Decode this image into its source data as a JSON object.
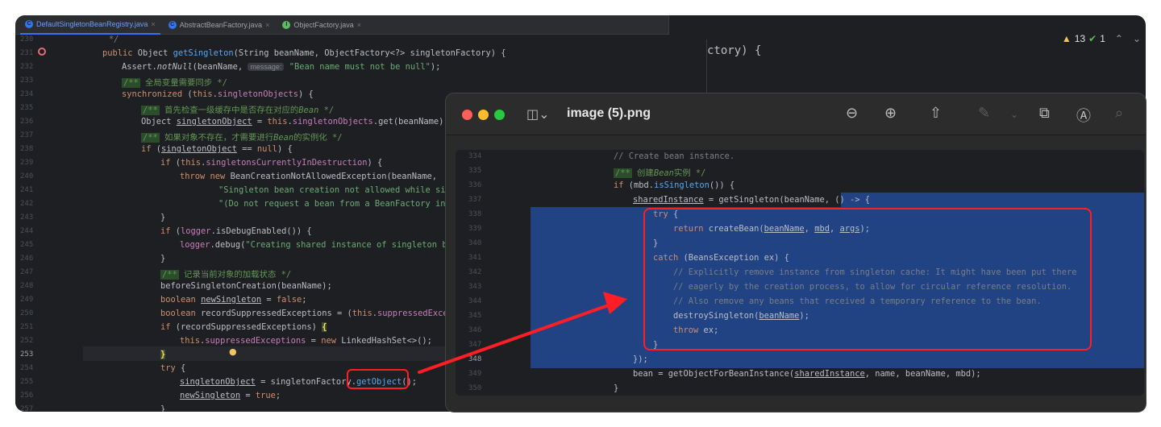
{
  "ide": {
    "tabs": [
      {
        "label": "DefaultSingletonBeanRegistry.java",
        "icon": "C",
        "color": "#3574f0",
        "active": true
      },
      {
        "label": "AbstractBeanFactory.java",
        "icon": "C",
        "color": "#3574f0",
        "active": false
      },
      {
        "label": "ObjectFactory.java",
        "icon": "I",
        "color": "#5fb865",
        "active": false
      }
    ],
    "close_glyph": "×",
    "line_numbers": [
      "230",
      "231",
      "232",
      "233",
      "234",
      "235",
      "236",
      "237",
      "238",
      "239",
      "240",
      "241",
      "242",
      "243",
      "244",
      "245",
      "246",
      "247",
      "248",
      "249",
      "250",
      "251",
      "252",
      "253",
      "254",
      "255",
      "256",
      "257"
    ],
    "code": {
      "l230": "*/",
      "l231_kw": "public",
      "l231_a": " Object ",
      "l231_fn": "getSingleton",
      "l231_b": "(String beanName, ObjectFactory<?> singletonFactory) {",
      "l232_a": "Assert.",
      "l232_fn": "notNull",
      "l232_b": "(beanName, ",
      "l232_hint": "message:",
      "l232_str": " \"Bean name must not be null\"",
      "l232_c": ");",
      "l233_doc": "/**",
      "l233_cmt": " 全局变量需要同步 */",
      "l234_kw": "synchronized",
      "l234_a": " (",
      "l234_kw2": "this",
      "l234_b": ".",
      "l234_field": "singletonObjects",
      "l234_c": ") {",
      "l235_doc": "/**",
      "l235_cmt": " 首先检查一级缓存中是否存在对应的",
      "l235_it": "Bean",
      "l235_end": " */",
      "l236_a": "Object ",
      "l236_ul": "singletonObject",
      "l236_b": " = ",
      "l236_kw": "this",
      "l236_c": ".",
      "l236_field": "singletonObjects",
      "l236_d": ".get(beanName);",
      "l237_doc": "/**",
      "l237_cmt": " 如果对象不存在，才需要进行",
      "l237_it": "Bean",
      "l237_end": "的实例化 */",
      "l238_kw": "if",
      "l238_a": " (",
      "l238_ul": "singletonObject",
      "l238_b": " == ",
      "l238_kw2": "null",
      "l238_c": ") {",
      "l239_kw": "if",
      "l239_a": " (",
      "l239_kw2": "this",
      "l239_b": ".",
      "l239_field": "singletonsCurrentlyInDestruction",
      "l239_c": ") {",
      "l240_kw": "throw new",
      "l240_a": " BeanCreationNotAllowedException(beanName,",
      "l241_str": "\"Singleton bean creation not allowed while sing",
      "l242_str": "\"(Do not request a bean from a BeanFactory in a",
      "l243": "}",
      "l244_kw": "if",
      "l244_a": " (",
      "l244_field": "logger",
      "l244_b": ".isDebugEnabled()) {",
      "l245_field": "logger",
      "l245_a": ".debug(",
      "l245_str": "\"Creating shared instance of singleton bea",
      "l246": "}",
      "l247_doc": "/**",
      "l247_cmt": " 记录当前对象的加载状态 */",
      "l248": "beforeSingletonCreation(beanName);",
      "l249_kw": "boolean",
      "l249_ul": "newSingleton",
      "l249_a": " = ",
      "l249_kw2": "false",
      "l249_b": ";",
      "l250_kw": "boolean",
      "l250_a": " recordSuppressedExceptions = (",
      "l250_kw2": "this",
      "l250_b": ".",
      "l250_field": "suppressedExcept",
      "l251_kw": "if",
      "l251_a": " (recordSuppressedExceptions) ",
      "l251_brace": "{",
      "l252_kw": "this",
      "l252_a": ".",
      "l252_field": "suppressedExceptions",
      "l252_b": " = ",
      "l252_kw2": "new",
      "l252_c": " LinkedHashSet<>();",
      "l253_brace": "}",
      "l253_bulb": "💡",
      "l254_kw": "try",
      "l254_a": " {",
      "l255_ul": "singletonObject",
      "l255_a": " = singletonFactory.",
      "l255_fn": "getObject",
      "l255_b": "();",
      "l256_ul": "newSingleton",
      "l256_a": " = ",
      "l256_kw": "true",
      "l256_b": ";",
      "l257": "}"
    },
    "right_code": "ctory) {",
    "inspections": {
      "warnings": "13",
      "ok": "1"
    }
  },
  "preview": {
    "title": "image (5).png",
    "toolbar_icons": [
      "sidebar-toggle-icon",
      "zoom-out-icon",
      "zoom-in-icon",
      "share-icon",
      "markup-pen-icon",
      "rotate-icon",
      "markup-circle-icon",
      "search-icon"
    ],
    "line_numbers": [
      "334",
      "335",
      "336",
      "337",
      "338",
      "339",
      "340",
      "341",
      "342",
      "343",
      "344",
      "345",
      "346",
      "347",
      "348",
      "349",
      "350"
    ],
    "code": {
      "l334": "// Create bean instance.",
      "l335_doc": "/**",
      "l335_a": " 创建",
      "l335_it": "Bean",
      "l335_b": "实例 */",
      "l336_kw": "if",
      "l336_a": " (mbd.",
      "l336_fn": "isSingleton",
      "l336_b": "()) {",
      "l337_ul": "sharedInstance",
      "l337_a": " = getSingleton(beanName, ",
      "l337_b": "() -> {",
      "l338_kw": "try",
      "l338_a": " {",
      "l339_kw": "return",
      "l339_a": " createBean(",
      "l339_p1": "beanName",
      "l339_c1": ", ",
      "l339_p2": "mbd",
      "l339_c2": ", ",
      "l339_p3": "args",
      "l339_end": ");",
      "l340": "}",
      "l341_kw": "catch",
      "l341_a": " (BeansException ex) {",
      "l342": "// Explicitly remove instance from singleton cache: It might have been put there",
      "l343": "// eagerly by the creation process, to allow for circular reference resolution.",
      "l344": "// Also remove any beans that received a temporary reference to the bean.",
      "l345_a": "destroySingleton(",
      "l345_p": "beanName",
      "l345_b": ");",
      "l346_kw": "throw",
      "l346_a": " ex;",
      "l347": "}",
      "l348": "});",
      "l349_a": "bean = getObjectForBeanInstance(",
      "l349_ul": "sharedInstance",
      "l349_b": ", name, beanName, mbd);",
      "l350": "}"
    }
  },
  "colors": {
    "highlight_red": "#ff1e26",
    "selection_blue": "#214283",
    "ide_bg": "#1e1f22"
  }
}
